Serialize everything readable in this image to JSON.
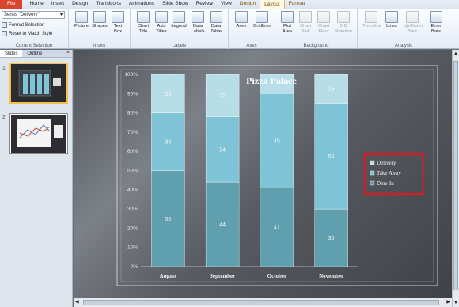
{
  "tabs": [
    {
      "label": "File",
      "kind": "file"
    },
    {
      "label": "Home"
    },
    {
      "label": "Insert"
    },
    {
      "label": "Design"
    },
    {
      "label": "Transitions"
    },
    {
      "label": "Animations"
    },
    {
      "label": "Slide Show"
    },
    {
      "label": "Review"
    },
    {
      "label": "View"
    },
    {
      "label": "Design",
      "kind": "ctx"
    },
    {
      "label": "Layout",
      "kind": "ctx",
      "active": true
    },
    {
      "label": "Format",
      "kind": "ctx"
    }
  ],
  "current_selection": {
    "select_value": "Series \"Delivery\"",
    "format_selection": "Format Selection",
    "reset_style": "Reset to Match Style",
    "group": "Current Selection"
  },
  "groups": {
    "insert": "Insert",
    "labels": "Labels",
    "axes": "Axes",
    "background": "Background",
    "analysis": "Analysis"
  },
  "buttons": [
    {
      "id": "picture",
      "label": "Picture",
      "icon": "picture-icon"
    },
    {
      "id": "shapes",
      "label": "Shapes",
      "icon": "shapes-icon"
    },
    {
      "id": "textbox",
      "label": "Text Box",
      "icon": "textbox-icon"
    },
    {
      "id": "charttitle",
      "label": "Chart Title",
      "icon": "chart-title-icon"
    },
    {
      "id": "axistitles",
      "label": "Axis Titles",
      "icon": "axis-titles-icon"
    },
    {
      "id": "legend",
      "label": "Legend",
      "icon": "legend-icon"
    },
    {
      "id": "datalabels",
      "label": "Data Labels",
      "icon": "data-labels-icon"
    },
    {
      "id": "datatable",
      "label": "Data Table",
      "icon": "data-table-icon"
    },
    {
      "id": "axes",
      "label": "Axes",
      "icon": "axes-icon"
    },
    {
      "id": "gridlines",
      "label": "Gridlines",
      "icon": "gridlines-icon"
    },
    {
      "id": "plotarea",
      "label": "Plot Area",
      "icon": "plot-area-icon"
    },
    {
      "id": "chartwall",
      "label": "Chart Wall",
      "icon": "chart-wall-icon",
      "disabled": true
    },
    {
      "id": "chartfloor",
      "label": "Chart Floor",
      "icon": "chart-floor-icon",
      "disabled": true
    },
    {
      "id": "rotation",
      "label": "3-D Rotation",
      "icon": "rotation-icon",
      "disabled": true
    },
    {
      "id": "trendline",
      "label": "Trendline",
      "icon": "trendline-icon",
      "disabled": true
    },
    {
      "id": "lines",
      "label": "Lines",
      "icon": "lines-icon"
    },
    {
      "id": "updown",
      "label": "Up/Down Bars",
      "icon": "updown-bars-icon",
      "disabled": true
    },
    {
      "id": "errorbars",
      "label": "Error Bars",
      "icon": "error-bars-icon"
    }
  ],
  "panel": {
    "tab_slides": "Slides",
    "tab_outline": "Outline",
    "close": "×",
    "slide1": "1",
    "slide2": "2"
  },
  "colors": {
    "dine_in": "#5f9fae",
    "take_away": "#7fc3d6",
    "delivery": "#b7dde8",
    "highlight": "#d01e24"
  },
  "chart_data": {
    "type": "bar",
    "stacked": "percent",
    "title": "Pizza Palace",
    "categories": [
      "August",
      "September",
      "October",
      "November"
    ],
    "series": [
      {
        "name": "Dine-In",
        "values": [
          50,
          44,
          41,
          30
        ]
      },
      {
        "name": "Take Away",
        "values": [
          30,
          34,
          49,
          55
        ]
      },
      {
        "name": "Delivery",
        "values": [
          20,
          22,
          10,
          15
        ]
      }
    ],
    "data_labels": [
      [
        "50",
        "44",
        "41",
        "30"
      ],
      [
        "30",
        "34",
        "49",
        "55"
      ],
      [
        "20",
        "22",
        "",
        "15"
      ]
    ],
    "yticks": [
      "0%",
      "10%",
      "20%",
      "30%",
      "40%",
      "50%",
      "60%",
      "70%",
      "80%",
      "90%",
      "100%"
    ],
    "ylim": [
      0,
      100
    ],
    "legend_position": "right",
    "legend_order": [
      "Delivery",
      "Take Away",
      "Dine-In"
    ],
    "grid": false
  }
}
